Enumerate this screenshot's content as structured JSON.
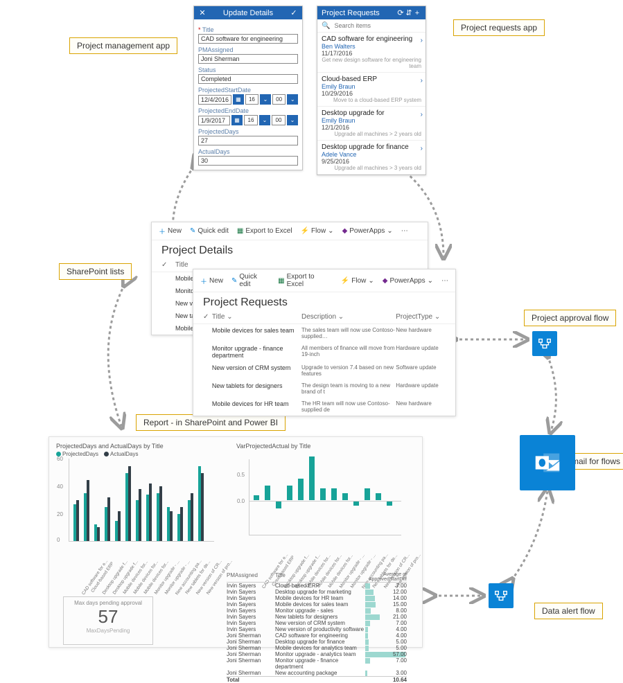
{
  "callouts": {
    "mgmt": "Project management app",
    "requests": "Project requests app",
    "splists": "SharePoint lists",
    "report": "Report - in SharePoint and Power BI",
    "approval": "Project approval flow",
    "email": "Email for flows",
    "dataalert": "Data alert flow"
  },
  "update_app": {
    "header": "Update Details",
    "fields": {
      "title_label": "Title",
      "title_value": "CAD software for engineering",
      "pm_label": "PMAssigned",
      "pm_value": "Joni Sherman",
      "status_label": "Status",
      "status_value": "Completed",
      "start_label": "ProjectedStartDate",
      "start_date": "12/4/2016",
      "start_hh": "16",
      "start_mm": "00",
      "end_label": "ProjectedEndDate",
      "end_date": "1/9/2017",
      "end_hh": "16",
      "end_mm": "00",
      "projdays_label": "ProjectedDays",
      "projdays_value": "27",
      "actualdays_label": "ActualDays",
      "actualdays_value": "30"
    }
  },
  "requests_app": {
    "header": "Project Requests",
    "search_placeholder": "Search items",
    "items": [
      {
        "title": "CAD software for engineering",
        "person": "Ben Walters",
        "date": "11/17/2016",
        "desc": "Get new design software for engineering team"
      },
      {
        "title": "Cloud-based ERP",
        "person": "Emily Braun",
        "date": "10/29/2016",
        "desc": "Move to a cloud-based ERP system"
      },
      {
        "title": "Desktop upgrade for",
        "person": "Emily Braun",
        "date": "12/1/2016",
        "desc": "Upgrade all machines > 2 years old"
      },
      {
        "title": "Desktop upgrade for finance",
        "person": "Adele Vance",
        "date": "9/25/2016",
        "desc": "Upgrade all machines > 3 years old"
      }
    ]
  },
  "sp": {
    "toolbar": {
      "new": "New",
      "quick": "Quick edit",
      "export": "Export to Excel",
      "flow": "Flow",
      "pa": "PowerApps"
    },
    "details_title": "Project Details",
    "requests_title": "Project Requests",
    "cols": {
      "title": "Title",
      "desc": "Description",
      "ptype": "ProjectType"
    },
    "details_rows": [
      "Mobile",
      "Monito",
      "New ve",
      "New ta",
      "Mobile"
    ],
    "requests_rows": [
      {
        "t": "Mobile devices for sales team",
        "d": "The sales team will now use Contoso-supplied…",
        "p": "New hardware"
      },
      {
        "t": "Monitor upgrade - finance department",
        "d": "All members of finance will move from 19-inch",
        "p": "Hardware update"
      },
      {
        "t": "New version of CRM system",
        "d": "Upgrade to version 7.4 based on new features",
        "p": "Software update"
      },
      {
        "t": "New tablets for designers",
        "d": "The design team is moving to a new brand of t",
        "p": "Hardware update"
      },
      {
        "t": "Mobile devices for HR team",
        "d": "The HR team will now use Contoso-supplied de",
        "p": "New hardware"
      }
    ]
  },
  "chart_data": [
    {
      "type": "bar",
      "title": "ProjectedDays and ActualDays by Title",
      "legend": [
        "ProjectedDays",
        "ActualDays"
      ],
      "ylim": [
        0,
        60
      ],
      "yticks": [
        0,
        20,
        40,
        60
      ],
      "categories": [
        "CAD software for e...",
        "Cloud-based ERP",
        "Desktop upgrade f...",
        "Desktop upgrade f...",
        "Mobile devices for...",
        "Mobile devices for...",
        "Mobile devices for...",
        "Monitor upgrade - ...",
        "Monitor upgrade - ...",
        "New accounting pa...",
        "New tablets for de...",
        "New version of CR...",
        "New version of pro..."
      ],
      "series": [
        {
          "name": "ProjectedDays",
          "values": [
            27,
            35,
            12,
            25,
            15,
            50,
            30,
            34,
            35,
            25,
            20,
            30,
            55
          ]
        },
        {
          "name": "ActualDays",
          "values": [
            30,
            45,
            10,
            32,
            22,
            55,
            38,
            42,
            40,
            22,
            25,
            35,
            50
          ]
        }
      ]
    },
    {
      "type": "bar",
      "title": "VarProjectedActual by Title",
      "ylim": [
        -0.5,
        1.0
      ],
      "yticks": [
        0.0,
        0.5
      ],
      "categories": [
        "CAD software for e...",
        "Cloud-based ERP",
        "Desktop upgrade f...",
        "Desktop upgrade f...",
        "Mobile devices for...",
        "Mobile devices for...",
        "Mobile devices for...",
        "Monitor upgrade - ...",
        "Monitor upgrade - ...",
        "New accounting pa...",
        "New tablets for de...",
        "New version of CR...",
        "New version of pro..."
      ],
      "values": [
        0.1,
        0.3,
        -0.15,
        0.3,
        0.45,
        0.9,
        0.25,
        0.25,
        0.15,
        -0.1,
        0.25,
        0.15,
        -0.1
      ]
    },
    {
      "type": "table",
      "title": "Average of ApprovedStartDiff",
      "columns": [
        "PMAssigned",
        "Title",
        "Average of ApprovedStartDiff"
      ],
      "rows": [
        [
          "Irvin Sayers",
          "Cloud-based ERP",
          7.0
        ],
        [
          "Irvin Sayers",
          "Desktop upgrade for marketing",
          12.0
        ],
        [
          "Irvin Sayers",
          "Mobile devices for HR team",
          14.0
        ],
        [
          "Irvin Sayers",
          "Mobile devices for sales team",
          15.0
        ],
        [
          "Irvin Sayers",
          "Monitor upgrade - sales",
          8.0
        ],
        [
          "Irvin Sayers",
          "New tablets for designers",
          21.0
        ],
        [
          "Irvin Sayers",
          "New version of CRM system",
          7.0
        ],
        [
          "Irvin Sayers",
          "New version of productivity software",
          4.0
        ],
        [
          "Joni Sherman",
          "CAD software for engineering",
          4.0
        ],
        [
          "Joni Sherman",
          "Desktop upgrade for finance",
          5.0
        ],
        [
          "Joni Sherman",
          "Mobile devices for analytics team",
          5.0
        ],
        [
          "Joni Sherman",
          "Monitor upgrade - analytics team",
          57.0
        ],
        [
          "Joni Sherman",
          "Monitor upgrade - finance department",
          7.0
        ],
        [
          "Joni Sherman",
          "New accounting package",
          3.0
        ]
      ],
      "total_label": "Total",
      "total_value": 10.64
    },
    {
      "type": "card",
      "title": "Max days pending approval",
      "value": 57,
      "sub": "MaxDaysPending"
    }
  ]
}
